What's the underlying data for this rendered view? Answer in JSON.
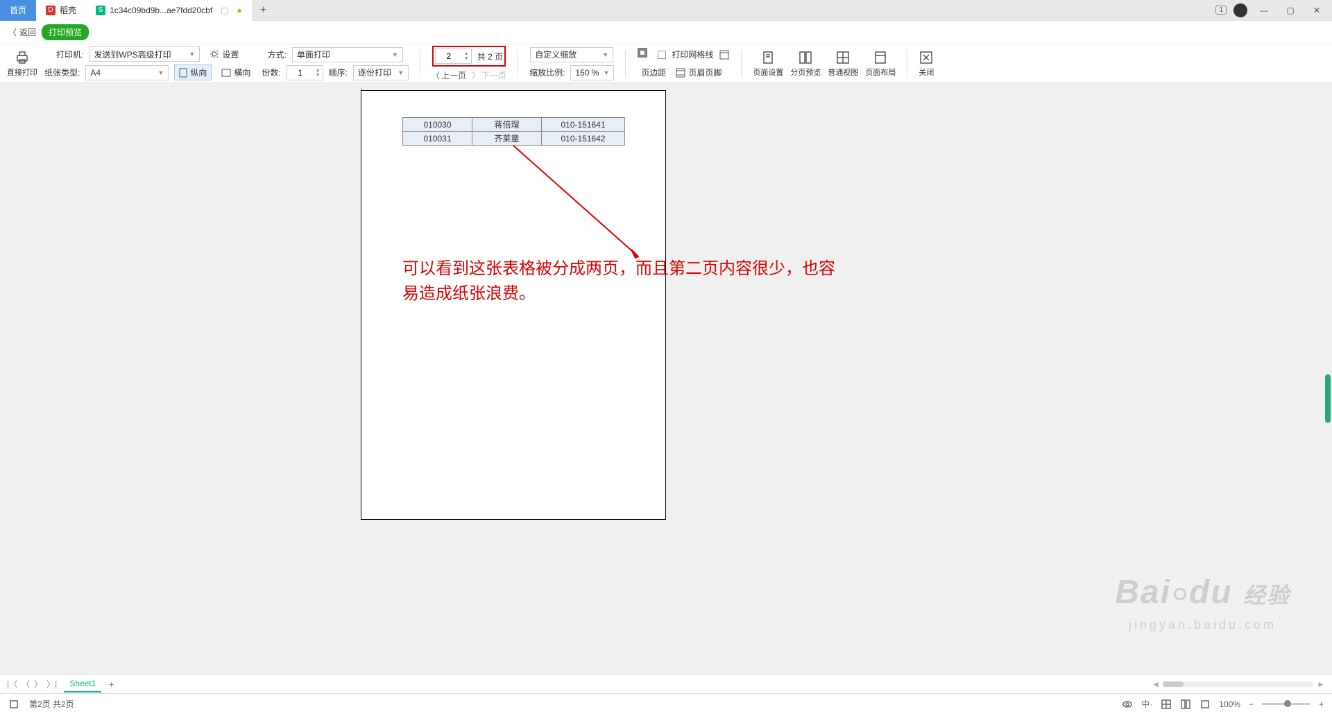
{
  "tabs": {
    "home": "首页",
    "daoke": "稻壳",
    "filename": "1c34c09bd9b...ae7fdd20cbf",
    "badge": "1"
  },
  "backbar": {
    "back": "返回",
    "title": "打印预览"
  },
  "toolbar": {
    "direct_print": "直接打印",
    "printer_label": "打印机:",
    "printer_value": "发送到WPS高级打印",
    "paper_label": "纸张类型:",
    "paper_value": "A4",
    "settings": "设置",
    "portrait": "纵向",
    "landscape": "横向",
    "mode_label": "方式:",
    "mode_value": "单面打印",
    "copies_label": "份数:",
    "copies_value": "1",
    "order_label": "顺序:",
    "order_value": "逐份打印",
    "page_current": "2",
    "page_total": "共 2 页",
    "prev_page": "上一页",
    "next_page": "下一页",
    "zoom_label": "自定义缩放",
    "scale_label": "缩放比例:",
    "scale_value": "150 %",
    "margins": "页边距",
    "header_footer": "页眉页脚",
    "grid": "打印网格线",
    "page_setup": "页面设置",
    "page_break": "分页预览",
    "normal_view": "普通视图",
    "page_layout": "页面布局",
    "close": "关闭"
  },
  "table": {
    "rows": [
      {
        "c1": "010030",
        "c2": "蒋倍瑁",
        "c3": "010-151641"
      },
      {
        "c1": "010031",
        "c2": "齐莱童",
        "c3": "010-151642"
      }
    ]
  },
  "annotation": {
    "line1": "可以看到这张表格被分成两页，而且第二页内容很少，也容",
    "line2": "易造成纸张浪费。"
  },
  "watermark": {
    "brand1": "Bai",
    "brand2": "du",
    "brand3": "经验",
    "url": "jingyan.baidu.com"
  },
  "sheet": {
    "name": "Sheet1"
  },
  "status": {
    "pageinfo": "第2页 共2页",
    "zoom": "100%"
  }
}
